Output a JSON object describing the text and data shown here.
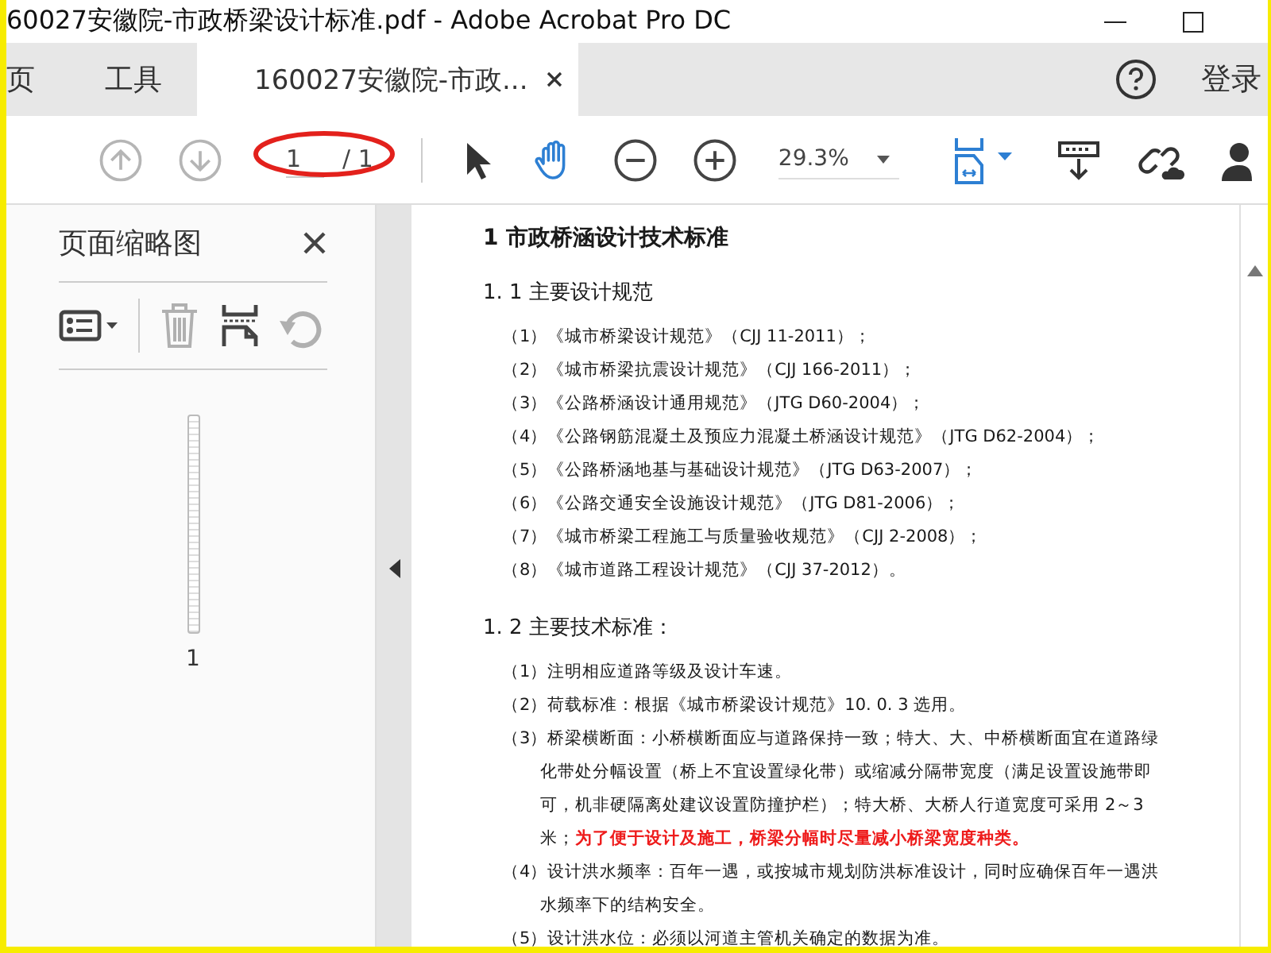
{
  "window": {
    "title": "60027安徽院-市政桥梁设计标准.pdf - Adobe Acrobat Pro DC"
  },
  "tabs": [
    {
      "label": "页",
      "selected": false,
      "closable": false
    },
    {
      "label": "工具",
      "selected": false,
      "closable": false
    },
    {
      "label": "160027安徽院-市政...",
      "selected": true,
      "closable": true
    }
  ],
  "sign_in": "登录",
  "toolbar": {
    "page_current": "1",
    "page_total": "/ 1",
    "zoom": "29.3%",
    "nav_buttons": [
      {
        "kind": "prev",
        "disabled": true
      },
      {
        "kind": "next",
        "disabled": true
      }
    ],
    "tools": [
      {
        "kind": "select",
        "selected": false
      },
      {
        "kind": "hand",
        "selected": true
      }
    ]
  },
  "thumbnails_panel": {
    "title": "页面缩略图",
    "tools": [
      {
        "kind": "options",
        "disabled": false
      },
      {
        "kind": "delete",
        "disabled": true
      },
      {
        "kind": "insert",
        "disabled": false
      },
      {
        "kind": "rotate",
        "disabled": true
      }
    ],
    "pages": [
      {
        "label": "1"
      }
    ]
  },
  "document": {
    "heading": "1  市政桥涵设计技术标准",
    "sections": [
      {
        "title": "1. 1 主要设计规范",
        "items": [
          "（1）《城市桥梁设计规范》（CJJ  11-2011）；",
          "（2）《城市桥梁抗震设计规范》（CJJ  166-2011）；",
          "（3）《公路桥涵设计通用规范》（JTG D60-2004）；",
          "（4）《公路钢筋混凝土及预应力混凝土桥涵设计规范》（JTG D62-2004）；",
          "（5）《公路桥涵地基与基础设计规范》（JTG D63-2007）；",
          "（6）《公路交通安全设施设计规范》（JTG D81-2006）；",
          "（7）《城市桥梁工程施工与质量验收规范》（CJJ  2-2008）；",
          "（8）《城市道路工程设计规范》（CJJ  37-2012）。"
        ]
      },
      {
        "title": "1. 2 主要技术标准：",
        "items": [
          "（1）注明相应道路等级及设计车速。",
          "（2）荷载标准：根据《城市桥梁设计规范》10. 0. 3 选用。",
          "（3）桥梁横断面：小桥横断面应与道路保持一致；特大、大、中桥横断面宜在道路绿化带处分幅设置（桥上不宜设置绿化带）或缩减分隔带宽度（满足设置设施带即可，机非硬隔离处建议设置防撞护栏）；特大桥、大桥人行道宽度可采用 2～3 米；**为了便于设计及施工，桥梁分幅时尽量减小桥梁宽度种类。**",
          "（4）设计洪水频率：百年一遇，或按城市规划防洪标准设计，同时应确保百年一遇洪水频率下的结构安全。",
          "（5）设计洪水位：必须以河道主管机关确定的数据为准。"
        ]
      }
    ]
  }
}
